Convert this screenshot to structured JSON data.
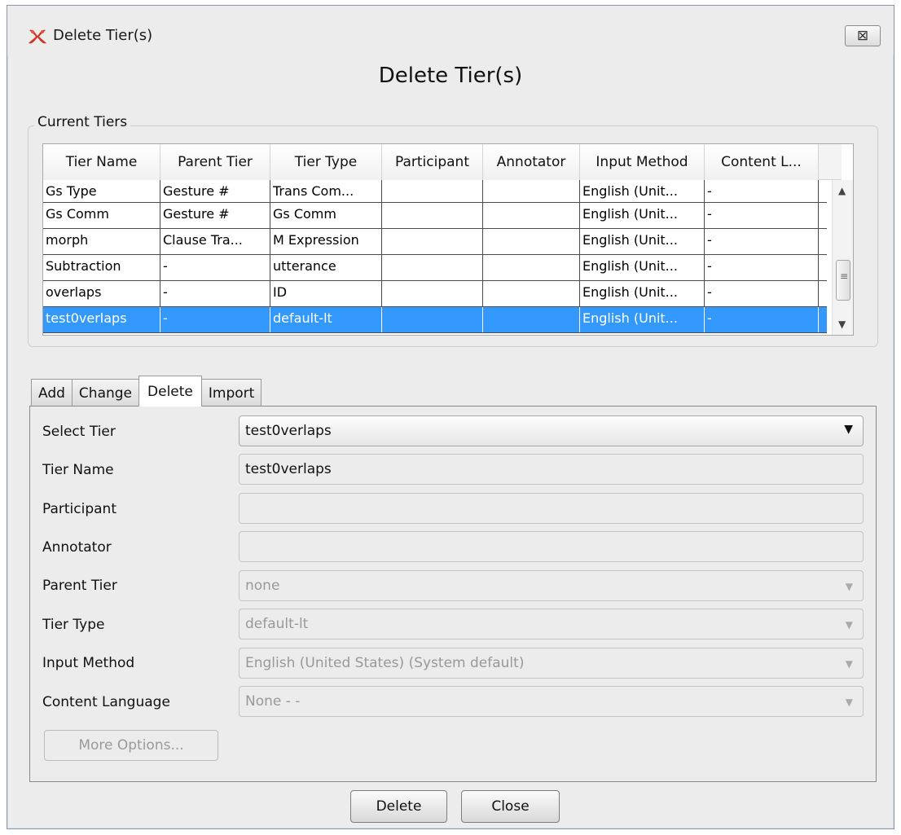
{
  "window": {
    "title": "Delete Tier(s)",
    "close_glyph": "⊠"
  },
  "heading": "Delete Tier(s)",
  "current_tiers": {
    "label": "Current Tiers",
    "columns": [
      "Tier Name",
      "Parent Tier",
      "Tier Type",
      "Participant",
      "Annotator",
      "Input Method",
      "Content L..."
    ],
    "rows": [
      [
        "Gs Type",
        "Gesture #",
        "Trans Com...",
        "",
        "",
        "English (Unit...",
        "-"
      ],
      [
        "Gs Comm",
        "Gesture #",
        "Gs Comm",
        "",
        "",
        "English (Unit...",
        "-"
      ],
      [
        "morph",
        "Clause Tra...",
        "M Expression",
        "",
        "",
        "English (Unit...",
        "-"
      ],
      [
        "Subtraction",
        "-",
        "utterance",
        "",
        "",
        "English (Unit...",
        "-"
      ],
      [
        "overlaps",
        "-",
        "ID",
        "",
        "",
        "English (Unit...",
        "-"
      ],
      [
        "test0verlaps",
        "-",
        "default-lt",
        "",
        "",
        "English (Unit...",
        "-"
      ]
    ],
    "selected_row": 5
  },
  "tabs": [
    {
      "label": "Add"
    },
    {
      "label": "Change"
    },
    {
      "label": "Delete",
      "active": true
    },
    {
      "label": "Import"
    }
  ],
  "form": {
    "select_tier": {
      "label": "Select Tier",
      "value": "test0verlaps"
    },
    "tier_name": {
      "label": "Tier Name",
      "value": "test0verlaps"
    },
    "participant": {
      "label": "Participant",
      "value": ""
    },
    "annotator": {
      "label": "Annotator",
      "value": ""
    },
    "parent_tier": {
      "label": "Parent Tier",
      "value": "none"
    },
    "tier_type": {
      "label": "Tier Type",
      "value": "default-lt"
    },
    "input_method": {
      "label": "Input Method",
      "value": "English (United States) (System default)"
    },
    "content_language": {
      "label": "Content Language",
      "value": "None -  -"
    },
    "more_options": "More Options..."
  },
  "buttons": {
    "delete": "Delete",
    "close": "Close"
  },
  "colors": {
    "selection": "#3399ff",
    "background": "#ececec",
    "app_icon": "#d4321e"
  }
}
